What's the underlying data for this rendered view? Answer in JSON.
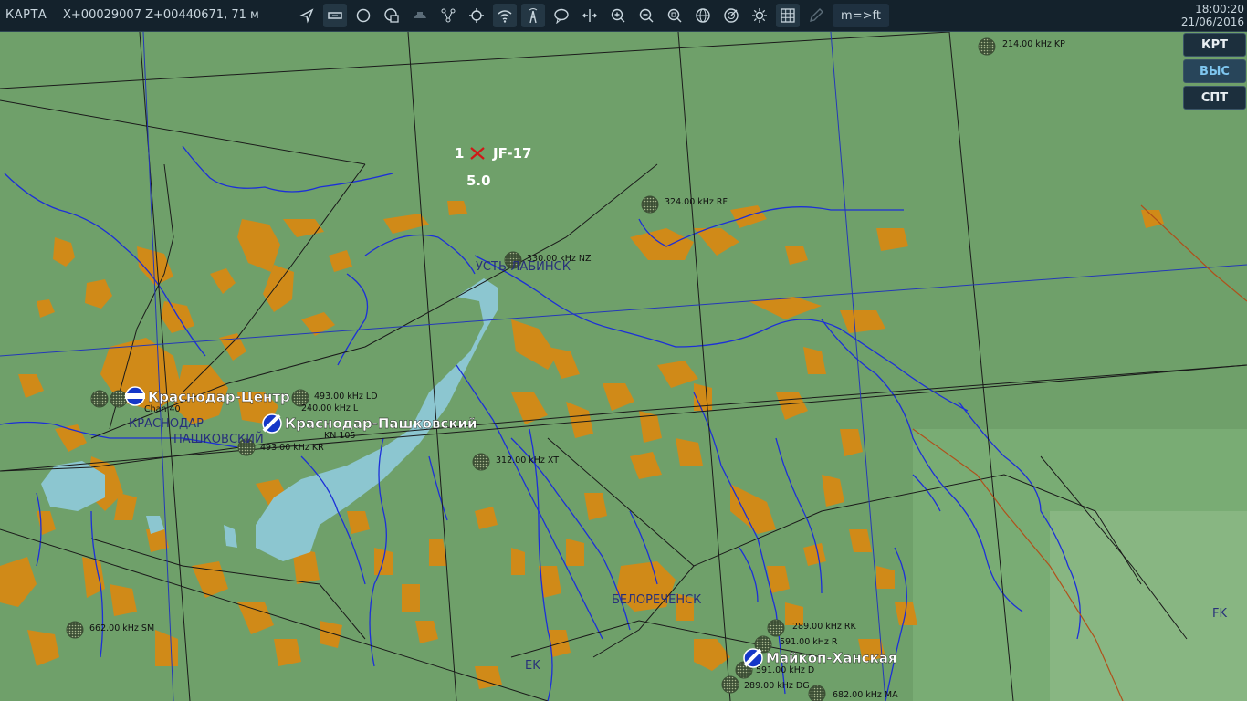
{
  "toolbar": {
    "title": "КАРТА",
    "coordinates": "X+00029007 Z+00440671, 71 м",
    "unit_toggle": "m=>ft",
    "time": "18:00:20",
    "date": "21/06/2016"
  },
  "side_buttons": [
    "КРТ",
    "ВЫС",
    "СПТ"
  ],
  "aircraft": {
    "count": "1",
    "name": "JF-17",
    "value": "5.0"
  },
  "airfields": [
    {
      "name": "Краснодар-Центр"
    },
    {
      "name": "Краснодар-Пашковский"
    },
    {
      "name": "Майкоп-Ханская"
    }
  ],
  "towns": [
    "УСТЬ-ЛАБИНСК",
    "КРАСНОДАР",
    "ПАШКОВСКИЙ",
    "БЕЛОРЕЧЕНСК",
    "FK",
    "EK"
  ],
  "beacons": [
    "214.00 kHz KP",
    "324.00 kHz RF",
    "330.00 kHz NZ",
    "493.00 kHz LD",
    "240.00 kHz L",
    "KN 105",
    "493.00 kHz KR",
    "312.00 kHz XT",
    "662.00 kHz SM",
    "289.00 kHz RK",
    "591.00 kHz R",
    "591.00 kHz D",
    "289.00 kHz DG",
    "682.00 kHz MA",
    "Chan 40"
  ],
  "colors": {
    "land": "#6fa06a",
    "forest_patch": "#d08a18",
    "river": "#1c2fd8",
    "water": "#8cc6d0",
    "grid": "#1a1a1a",
    "meridian": "#2438b8",
    "toolbar": "#14222c",
    "active_button": "#7fc6ef"
  },
  "icons": [
    "arrow-icon",
    "ruler-icon",
    "circle-icon",
    "layers-icon",
    "vehicle-icon",
    "route-icon",
    "crosshair-icon",
    "wifi-icon",
    "tower-icon",
    "chat-icon",
    "arrows-icon",
    "zoom-in-icon",
    "zoom-out-icon",
    "zoom-fit-icon",
    "globe-icon",
    "radar-icon",
    "sun-icon",
    "grid-icon",
    "pencil-icon"
  ]
}
